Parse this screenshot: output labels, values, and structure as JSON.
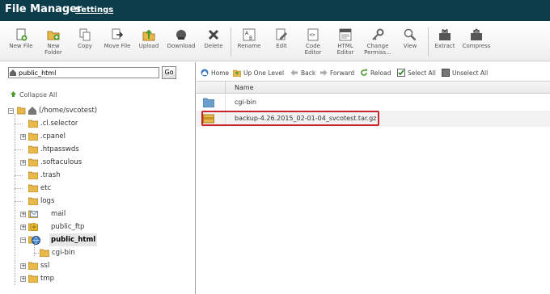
{
  "app": {
    "title": "File Manager",
    "settings_link": "Settings"
  },
  "toolbar": {
    "new_file": "New File",
    "new_folder_1": "New",
    "new_folder_2": "Folder",
    "copy": "Copy",
    "move_file": "Move File",
    "upload": "Upload",
    "download": "Download",
    "delete": "Delete",
    "rename": "Rename",
    "edit": "Edit",
    "code_editor_1": "Code",
    "code_editor_2": "Editor",
    "html_editor_1": "HTML",
    "html_editor_2": "Editor",
    "change_perms_1": "Change",
    "change_perms_2": "Permiss...",
    "view": "View",
    "extract": "Extract",
    "compress": "Compress"
  },
  "left": {
    "path_value": "public_html",
    "go_label": "Go",
    "collapse_all": "Collapse All",
    "tree": [
      {
        "label": "(/home/svcotest)",
        "icon": "home-icon"
      },
      {
        "label": ".cl.selector",
        "icon": "folder-icon"
      },
      {
        "label": ".cpanel",
        "icon": "folder-icon"
      },
      {
        "label": ".htpasswds",
        "icon": "folder-icon"
      },
      {
        "label": ".softaculous",
        "icon": "folder-icon"
      },
      {
        "label": ".trash",
        "icon": "folder-icon"
      },
      {
        "label": "etc",
        "icon": "folder-icon"
      },
      {
        "label": "logs",
        "icon": "folder-icon"
      },
      {
        "label": "mail",
        "icon": "mail-folder-icon"
      },
      {
        "label": "public_ftp",
        "icon": "ftp-folder-icon"
      },
      {
        "label": "public_html",
        "icon": "globe-folder-icon"
      },
      {
        "label": "cgi-bin",
        "icon": "folder-icon"
      },
      {
        "label": "ssl",
        "icon": "folder-icon"
      },
      {
        "label": "tmp",
        "icon": "folder-icon"
      }
    ]
  },
  "right": {
    "toolbar": {
      "home": "Home",
      "up_one_level": "Up One Level",
      "back": "Back",
      "forward": "Forward",
      "reload": "Reload",
      "select_all": "Select All",
      "unselect_all": "Unselect All"
    },
    "column_name": "Name",
    "files": [
      {
        "name": "cgi-bin",
        "icon": "folder-icon"
      },
      {
        "name": "backup-4.26.2015_02-01-04_svcotest.tar.gz",
        "icon": "archive-icon"
      }
    ]
  },
  "colors": {
    "topbar": "#0d3d4b",
    "highlight": "#c9242b",
    "folder": "#e8b84a"
  }
}
